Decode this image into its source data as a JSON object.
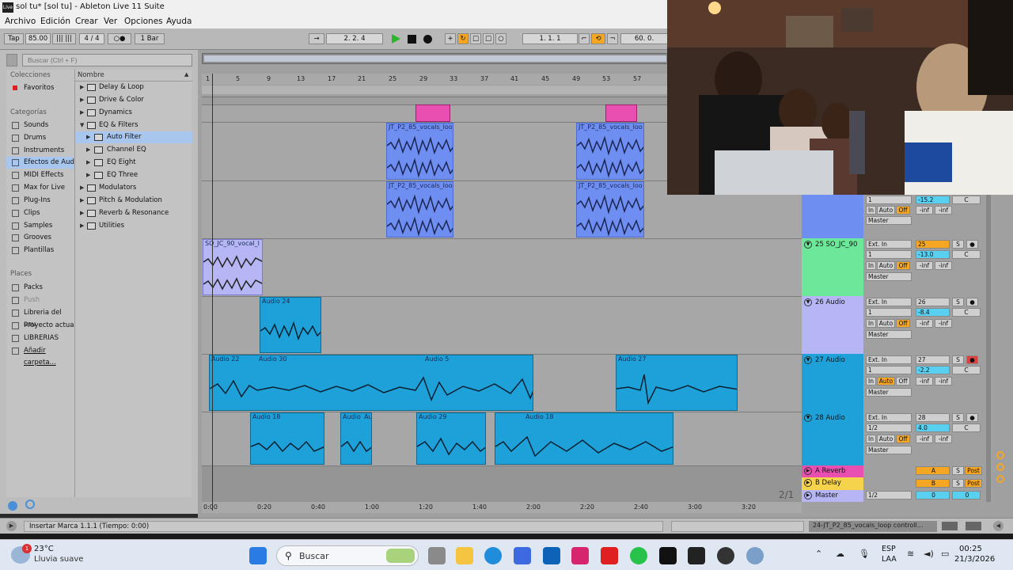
{
  "window": {
    "title": "sol tu* [sol tu] - Ableton Live 11 Suite",
    "logo": "Live"
  },
  "menu": [
    "Archivo",
    "Edición",
    "Crear",
    "Ver",
    "Opciones",
    "Ayuda"
  ],
  "menu_underlines": [
    "A",
    "E",
    "C",
    "V",
    "O",
    "A"
  ],
  "transport": {
    "tap": "Tap",
    "tempo": "85.00",
    "signature": "4 / 4",
    "metronome": "○●",
    "quantize": "1 Bar",
    "position": "2.  2.  4",
    "loop_start": "1.  1.  1",
    "loop_length": "60.  0."
  },
  "browser": {
    "search_placeholder": "Buscar (Ctrl + F)",
    "collections_header": "Colecciones",
    "favorites": "Favoritos",
    "categories_header": "Categorías",
    "categories": [
      "Sounds",
      "Drums",
      "Instruments",
      "Efectos de Aud",
      "MIDI Effects",
      "Max for Live",
      "Plug-Ins",
      "Clips",
      "Samples",
      "Grooves",
      "Plantillas"
    ],
    "places_header": "Places",
    "places": [
      "Packs",
      "Push",
      "Libreria del usu",
      "Proyecto actua",
      "LIBRERIAS",
      "Añadir carpeta..."
    ],
    "name_header": "Nombre",
    "tree": [
      {
        "label": "Delay & Loop",
        "level": 0,
        "open": false
      },
      {
        "label": "Drive & Color",
        "level": 0,
        "open": false
      },
      {
        "label": "Dynamics",
        "level": 0,
        "open": false
      },
      {
        "label": "EQ & Filters",
        "level": 0,
        "open": true
      },
      {
        "label": "Auto Filter",
        "level": 1,
        "open": false,
        "selected": true
      },
      {
        "label": "Channel EQ",
        "level": 1,
        "open": false
      },
      {
        "label": "EQ Eight",
        "level": 1,
        "open": false
      },
      {
        "label": "EQ Three",
        "level": 1,
        "open": false
      },
      {
        "label": "Modulators",
        "level": 0,
        "open": false
      },
      {
        "label": "Pitch & Modulation",
        "level": 0,
        "open": false
      },
      {
        "label": "Reverb & Resonance",
        "level": 0,
        "open": false
      },
      {
        "label": "Utilities",
        "level": 0,
        "open": false
      }
    ]
  },
  "ruler_bars": [
    "1",
    "5",
    "9",
    "13",
    "17",
    "21",
    "25",
    "29",
    "33",
    "37",
    "41",
    "45",
    "49",
    "53",
    "57"
  ],
  "time_ruler": [
    "0:00",
    "0:20",
    "0:40",
    "1:00",
    "1:20",
    "1:40",
    "2:00",
    "2:20",
    "2:40",
    "3:00",
    "3:20"
  ],
  "page_indicator": "2/1",
  "clips": {
    "jt1": "JT_P2_85_vocals_loo",
    "jt2": "JT_P2_85_vocals_loo",
    "jt3": "JT_P2_85_vocals_loo",
    "jt4": "JT_P2_85_vocals_loo",
    "so": "SO_JC_90_vocal_l",
    "a24": "Audio 24",
    "a22": "Audio 22",
    "a30": "Audio 30",
    "a5": "Audio 5",
    "a27": "Audio 27",
    "a18a": "Audio 18",
    "a_au": "Audio",
    "a_au2": "Au",
    "a29": "Audio 29",
    "a18b": "Audio 18"
  },
  "tracks": [
    {
      "name": "25 SO_JC_90",
      "color": "#6de89a",
      "input": "Ext. In",
      "channel": "1",
      "number": "25",
      "volume": "-13.0",
      "pan": "C",
      "peak": "-inf",
      "peak2": "-inf",
      "output": "Master"
    },
    {
      "name": "26 Audio",
      "color": "#b6b6f5",
      "input": "Ext. In",
      "channel": "1",
      "number": "26",
      "volume": "-8.4",
      "pan": "C",
      "peak": "-inf",
      "peak2": "-inf",
      "output": "Master"
    },
    {
      "name": "27 Audio",
      "color": "#1ea1d8",
      "input": "Ext. In",
      "channel": "1",
      "number": "27",
      "volume": "-2.2",
      "pan": "C",
      "peak": "-inf",
      "peak2": "-inf",
      "output": "Master"
    },
    {
      "name": "28 Audio",
      "color": "#1ea1d8",
      "input": "Ext. In",
      "channel": "1/2",
      "number": "28",
      "volume": "4.0",
      "pan": "C",
      "peak": "-inf",
      "peak2": "-inf",
      "output": "Master"
    }
  ],
  "top_mixer": {
    "volume": "-15.2",
    "pan": "C",
    "peak": "-inf",
    "peak2": "-inf",
    "output": "Master"
  },
  "returns": [
    {
      "name": "A Reverb",
      "letter": "A",
      "s": "S",
      "post": "Post"
    },
    {
      "name": "B Delay",
      "letter": "B",
      "s": "S",
      "post": "Post"
    },
    {
      "name": "Master",
      "letter": "0",
      "s": "",
      "post": "0",
      "routing": "1/2"
    }
  ],
  "mixer_labels": {
    "in": "In",
    "auto": "Auto",
    "off": "Off",
    "solo": "S",
    "master": "Master"
  },
  "status": {
    "message": "Insertar Marca 1.1.1 (Tiempo: 0:00)",
    "selection": "24-JT_P2_85_vocals_loop controll..."
  },
  "taskbar": {
    "temp": "23°C",
    "weather": "Lluvia suave",
    "notif": "1",
    "search": "Buscar",
    "lang": "ESP",
    "layout": "LAA",
    "time": "00:25",
    "date": "21/3/2026"
  },
  "colors": {
    "clip_blue": "#6f8ef2",
    "clip_cyan": "#1ea1d8",
    "clip_pink": "#e84fb0",
    "accent_orange": "#f5a623"
  }
}
